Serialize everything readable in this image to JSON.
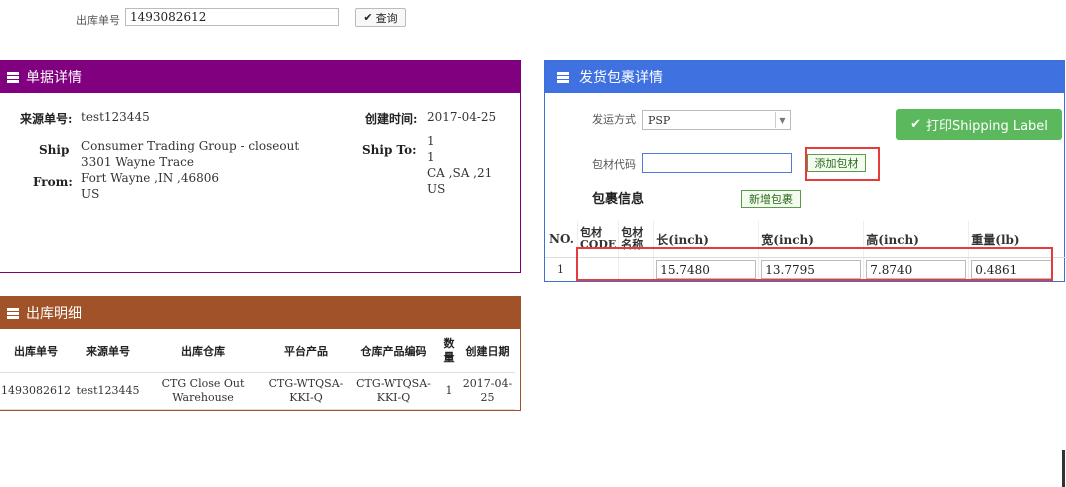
{
  "search": {
    "label": "出库单号",
    "value": "1493082612",
    "button_label": "查询"
  },
  "order_panel": {
    "title": "单据详情",
    "source_no_label": "来源单号:",
    "source_no": "test123445",
    "created_label": "创建时间:",
    "created": "2017-04-25",
    "ship_from_label_1": "Ship",
    "ship_from_label_2": "From:",
    "ship_from": [
      "Consumer Trading Group - closeout",
      "3301 Wayne Trace",
      "Fort Wayne ,IN ,46806",
      "US"
    ],
    "ship_to_label": "Ship To:",
    "ship_to": [
      "1",
      "1",
      "CA ,SA ,21",
      "US"
    ]
  },
  "package_panel": {
    "title": "发货包裹详情",
    "ship_method_label": "发运方式",
    "ship_method": "PSP",
    "print_button": "打印Shipping Label",
    "material_code_label": "包材代码",
    "material_code_value": "",
    "add_material_button": "添加包材",
    "package_info_title": "包裹信息",
    "new_package_button": "新增包裹",
    "columns": [
      "NO.",
      "包材CODE",
      "包材名称",
      "长(inch)",
      "宽(inch)",
      "高(inch)",
      "重量(lb)"
    ],
    "rows": [
      {
        "no": "1",
        "code": "",
        "name": "",
        "length": "15.7480",
        "width": "13.7795",
        "height": "7.8740",
        "weight": "0.4861"
      }
    ]
  },
  "outbound_panel": {
    "title": "出库明细",
    "columns": [
      "出库单号",
      "来源单号",
      "出库仓库",
      "平台产品",
      "仓库产品编码",
      "数量",
      "创建日期"
    ],
    "rows": [
      {
        "outbound_no": "1493082612",
        "source_no": "test123445",
        "warehouse": "CTG Close Out Warehouse",
        "platform_product": "CTG-WTQSA-KKI-Q",
        "warehouse_code": "CTG-WTQSA-KKI-Q",
        "qty": "1",
        "created": "2017-04-25"
      }
    ]
  },
  "colors": {
    "order_header": "#800080",
    "package_header": "#3f72e0",
    "outbound_header": "#a25228",
    "print_button": "#5cb85c",
    "highlight": "#e53b3b"
  }
}
